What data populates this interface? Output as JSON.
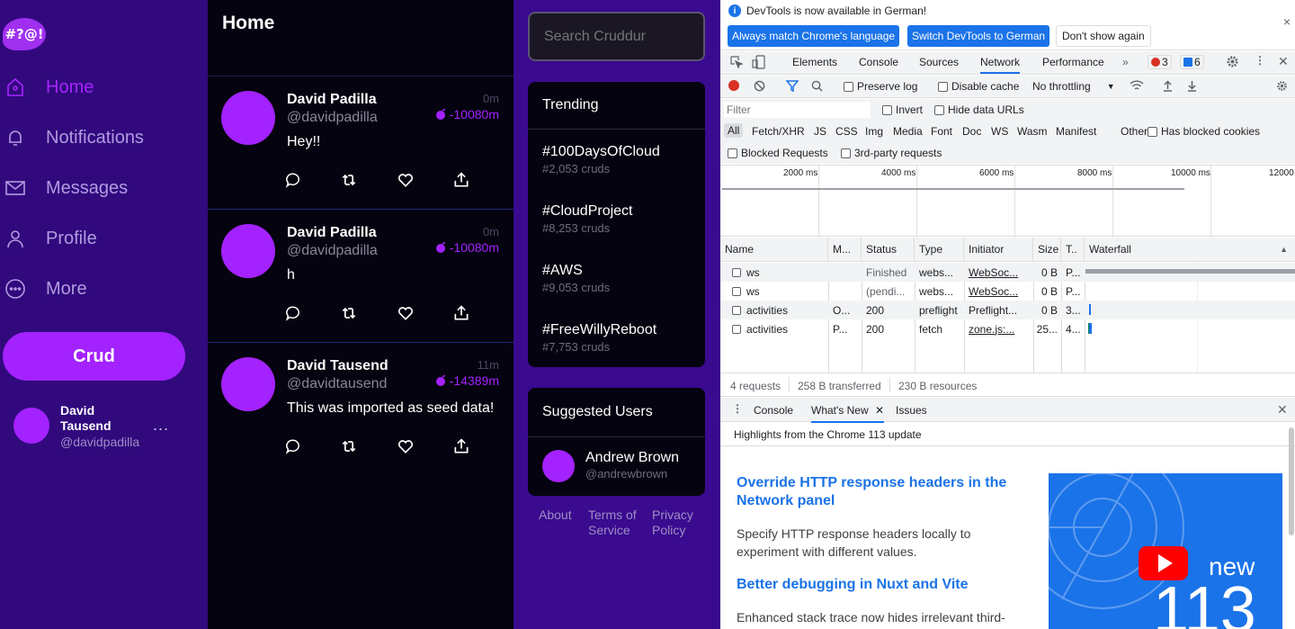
{
  "app": {
    "logo_text": "#?@!",
    "nav": [
      {
        "label": "Home",
        "icon": "home-icon"
      },
      {
        "label": "Notifications",
        "icon": "bell-icon"
      },
      {
        "label": "Messages",
        "icon": "envelope-icon"
      },
      {
        "label": "Profile",
        "icon": "person-icon"
      },
      {
        "label": "More",
        "icon": "more-circle-icon"
      }
    ],
    "crud_button": "Crud",
    "profile": {
      "name": "David Tausend",
      "handle": "@davidpadilla",
      "more": "..."
    }
  },
  "feed": {
    "title": "Home",
    "items": [
      {
        "name": "David Padilla",
        "handle": "@davidpadilla",
        "time": "0m",
        "expires": "-10080m",
        "message": "Hey!!"
      },
      {
        "name": "David Padilla",
        "handle": "@davidpadilla",
        "time": "0m",
        "expires": "-10080m",
        "message": "h"
      },
      {
        "name": "David Tausend",
        "handle": "@davidtausend",
        "time": "11m",
        "expires": "-14389m",
        "message": "This was imported as seed data!"
      }
    ]
  },
  "right": {
    "search_placeholder": "Search Cruddur",
    "trending_title": "Trending",
    "trends": [
      {
        "tag": "#100DaysOfCloud",
        "count": "#2,053 cruds"
      },
      {
        "tag": "#CloudProject",
        "count": "#8,253 cruds"
      },
      {
        "tag": "#AWS",
        "count": "#9,053 cruds"
      },
      {
        "tag": "#FreeWillyReboot",
        "count": "#7,753 cruds"
      }
    ],
    "suggested_title": "Suggested Users",
    "suggested": {
      "name": "Andrew Brown",
      "handle": "@andrewbrown"
    },
    "footer": {
      "about": "About",
      "terms": "Terms of Service",
      "privacy": "Privacy Policy"
    }
  },
  "devtools": {
    "banner": {
      "info": "i",
      "text": "DevTools is now available in German!",
      "btn_match": "Always match Chrome's language",
      "btn_switch": "Switch DevTools to German",
      "btn_dont": "Don't show again",
      "close": "×"
    },
    "tabs": [
      "Elements",
      "Console",
      "Sources",
      "Network",
      "Performance"
    ],
    "more_tabs": "»",
    "errors": "3",
    "messages": "6",
    "toolbar": {
      "preserve_log": "Preserve log",
      "disable_cache": "Disable cache",
      "throttling": "No throttling"
    },
    "filter": {
      "placeholder": "Filter",
      "invert": "Invert",
      "hide_data": "Hide data URLs",
      "types": [
        "All",
        "Fetch/XHR",
        "JS",
        "CSS",
        "Img",
        "Media",
        "Font",
        "Doc",
        "WS",
        "Wasm",
        "Manifest",
        "Other"
      ],
      "has_blocked_cookies": "Has blocked cookies",
      "blocked_requests": "Blocked Requests",
      "third_party": "3rd-party requests"
    },
    "timeline_labels": [
      "2000 ms",
      "4000 ms",
      "6000 ms",
      "8000 ms",
      "10000 ms",
      "12000"
    ],
    "columns": [
      "Name",
      "M...",
      "Status",
      "Type",
      "Initiator",
      "Size",
      "T..",
      "Waterfall"
    ],
    "rows": [
      {
        "name": "ws",
        "method": "",
        "status": "Finished",
        "type": "webs...",
        "initiator": "WebSoc...",
        "size": "0 B",
        "time": "P..."
      },
      {
        "name": "ws",
        "method": "",
        "status": "(pendi...",
        "type": "webs...",
        "initiator": "WebSoc...",
        "size": "0 B",
        "time": "P..."
      },
      {
        "name": "activities",
        "method": "O...",
        "status": "200",
        "type": "preflight",
        "initiator": "Preflight...",
        "size": "0 B",
        "time": "3..."
      },
      {
        "name": "activities",
        "method": "P...",
        "status": "200",
        "type": "fetch",
        "initiator": "zone.js:...",
        "size": "25...",
        "time": "4..."
      }
    ],
    "summary": {
      "requests": "4 requests",
      "transferred": "258 B transferred",
      "resources": "230 B resources"
    },
    "drawer": {
      "tabs": [
        "Console",
        "What's New",
        "Issues"
      ],
      "highlights": "Highlights from the Chrome 113 update"
    },
    "whats_new": {
      "h1": "Override HTTP response headers in the Network panel",
      "p1": "Specify HTTP response headers locally to experiment with different values.",
      "h2": "Better debugging in Nuxt and Vite",
      "p2": "Enhanced stack trace now hides irrelevant third-",
      "img_new": "new",
      "img_num": "113"
    }
  }
}
